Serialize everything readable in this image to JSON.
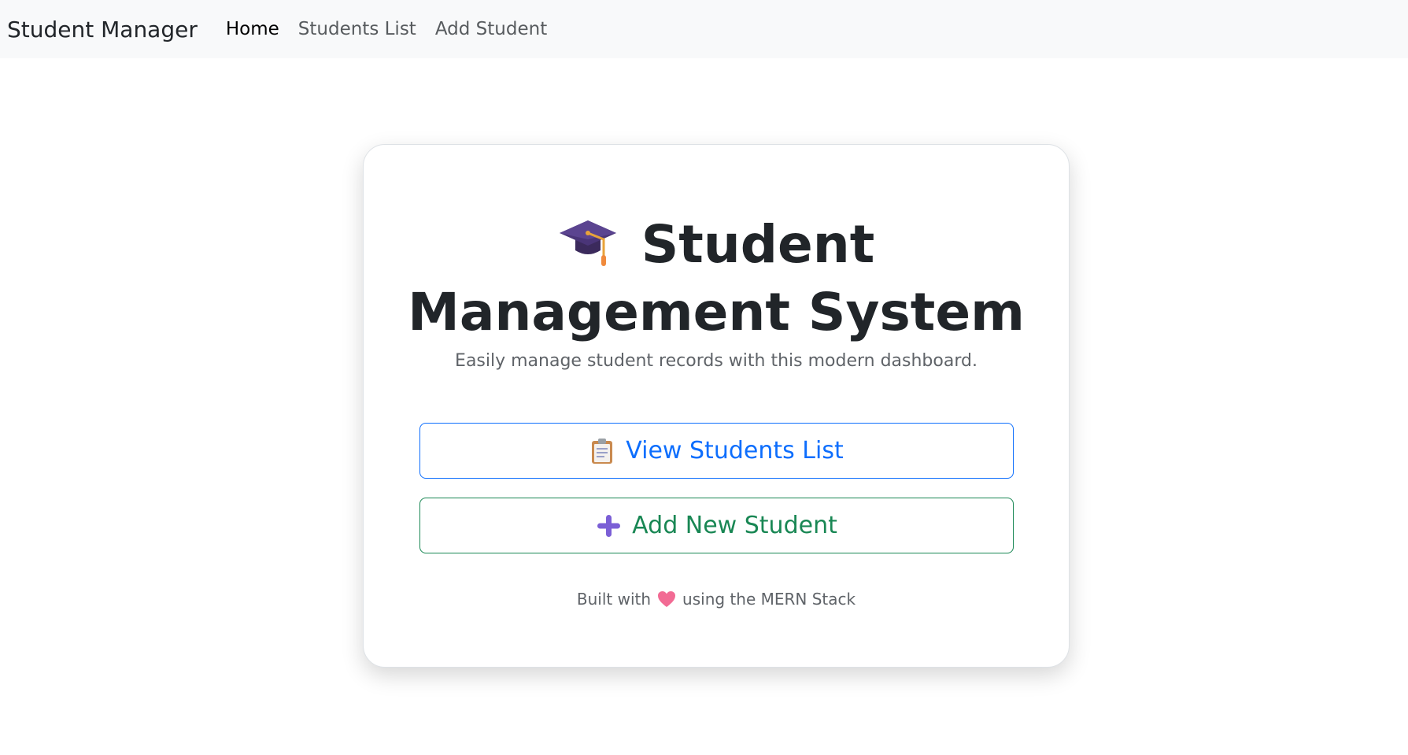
{
  "navbar": {
    "brand": "Student Manager",
    "links": [
      {
        "label": "Home",
        "active": true
      },
      {
        "label": "Students List",
        "active": false
      },
      {
        "label": "Add Student",
        "active": false
      }
    ]
  },
  "hero": {
    "icon": "graduation-cap-icon",
    "title_line1": "Student",
    "title_line2": "Management System",
    "subtitle": "Easily manage student records with this modern dashboard."
  },
  "actions": {
    "view": {
      "icon": "clipboard-icon",
      "label": "View Students List"
    },
    "add": {
      "icon": "plus-icon",
      "label": "Add New Student"
    }
  },
  "footer": {
    "prefix": "Built with",
    "icon": "heart-icon",
    "suffix": "using the MERN Stack"
  },
  "colors": {
    "primary": "#0d6efd",
    "success": "#198754",
    "navbar_bg": "#f8f9fa",
    "text_dark": "#212529"
  }
}
